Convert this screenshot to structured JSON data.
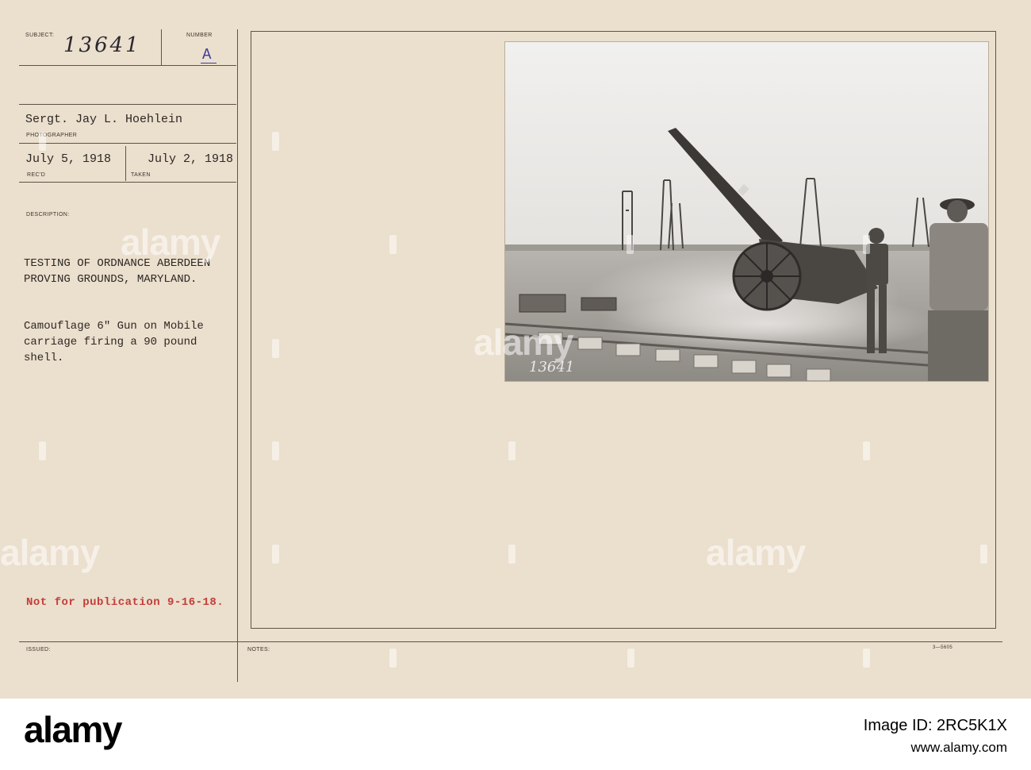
{
  "record": {
    "subject_label": "SUBJECT:",
    "subject_value": "13641",
    "number_label": "NUMBER",
    "number_value": "A",
    "photographer": "Sergt. Jay L. Hoehlein",
    "photographer_label": "PHOTOGRAPHER",
    "received": "July 5, 1918",
    "received_label": "REC'D",
    "taken": "July 2, 1918",
    "taken_label": "TAKEN",
    "description_label": "DESCRIPTION:",
    "description_line1": "TESTING OF ORDNANCE ABERDEEN",
    "description_line2": "PROVING GROUNDS, MARYLAND.",
    "caption_line1": "Camouflage 6\" Gun on Mobile",
    "caption_line2": "carriage firing a 90 pound",
    "caption_line3": "shell.",
    "restriction": "Not for publication 9-16-18.",
    "issued_label": "ISSUED:",
    "notes_label": "NOTES:",
    "form_code": "3—5605",
    "photo_number": "13641"
  },
  "watermark": {
    "text": "alamy"
  },
  "footer": {
    "logo": "alamy",
    "image_id_line": "Image ID: 2RC5K1X",
    "site_line": "www.alamy.com"
  },
  "colors": {
    "card": "#ebdfcd",
    "ink": "#2c2825",
    "stamp_blue": "#3a3f9a",
    "stamp_red": "#c23d3a"
  }
}
